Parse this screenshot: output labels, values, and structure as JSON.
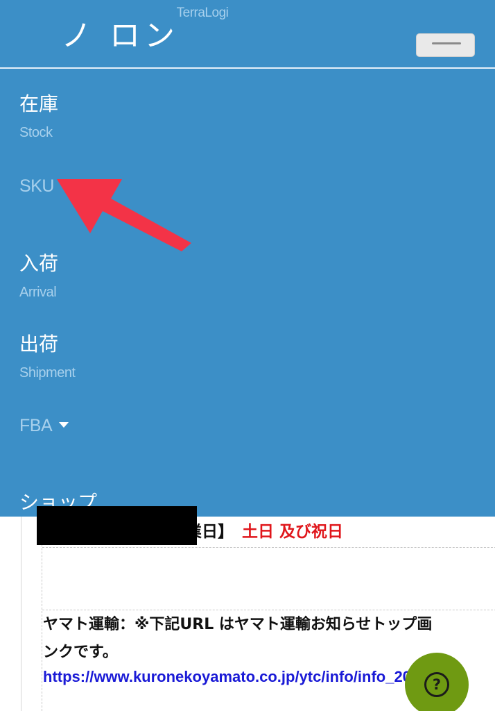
{
  "header": {
    "brand": "TerraLogi",
    "brand_partial": "ノ ロン",
    "menu_toggle_icon": "hamburger-icon"
  },
  "nav": {
    "items": [
      {
        "jp": "在庫",
        "en": "Stock"
      },
      {
        "sub": "SKU"
      },
      {
        "jp": "入荷",
        "en": "Arrival"
      },
      {
        "jp": "出荷",
        "en": "Shipment"
      },
      {
        "sub": "FBA",
        "icon": "caret-down-icon"
      },
      {
        "jp": "ショップ"
      }
    ]
  },
  "annotation": {
    "arrow_color": "#f33347",
    "points_to": "SKU"
  },
  "content": {
    "holiday_prefix": "業日】",
    "holiday_value": "土日 及び祝日",
    "yamato_line1": "ヤマト運輸：※下記URL はヤマト運輸お知らせトップ画",
    "yamato_line2": "ンクです。",
    "yamato_link": "https://www.kuronekoyamato.co.jp/ytc/info/info_20"
  },
  "help": {
    "symbol": "?",
    "icon": "help-question-icon",
    "color": "#6f9a12"
  },
  "colors": {
    "nav_background": "#3c8fc7",
    "holiday_red": "#e0161b",
    "link_blue": "#1a1ad6"
  }
}
